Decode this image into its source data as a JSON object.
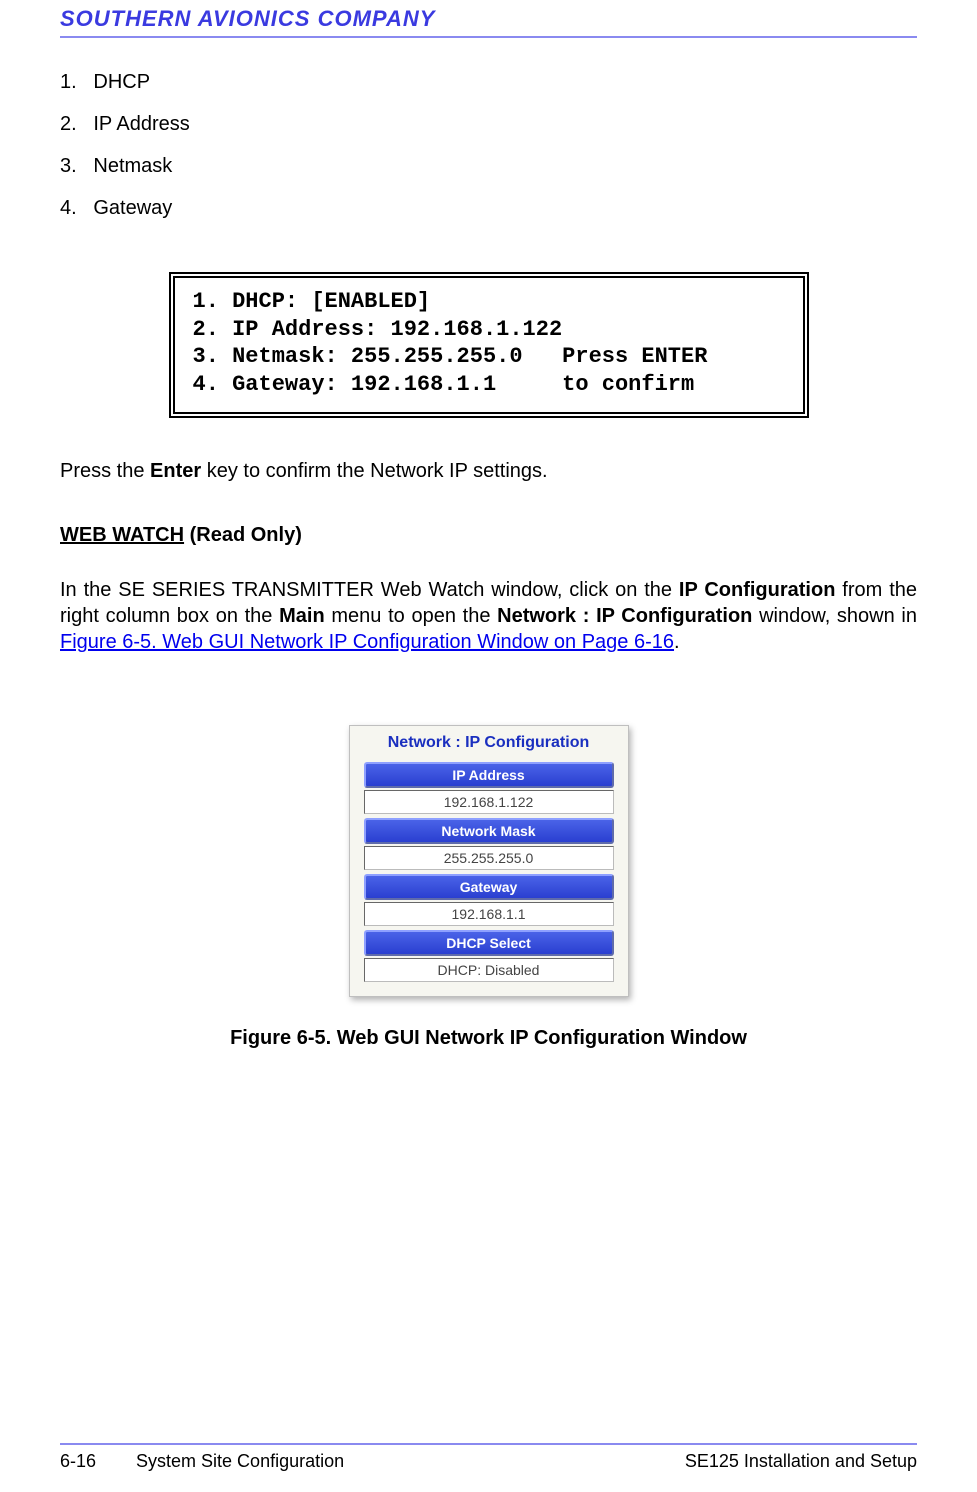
{
  "header": {
    "company": "SOUTHERN AVIONICS COMPANY"
  },
  "list": {
    "items": [
      {
        "num": "1.",
        "label": "DHCP"
      },
      {
        "num": "2.",
        "label": "IP Address"
      },
      {
        "num": "3.",
        "label": "Netmask"
      },
      {
        "num": "4.",
        "label": "Gateway"
      }
    ]
  },
  "lcd": {
    "line1": "1. DHCP: [ENABLED]",
    "line2": "2. IP Address: 192.168.1.122",
    "line3a": "3. Netmask: 255.255.255.0",
    "line3b": "Press ENTER",
    "line4a": "4. Gateway: 192.168.1.1",
    "line4b": "to confirm"
  },
  "para1": {
    "pre": "Press the ",
    "bold": "Enter",
    "post": " key to confirm the Network IP settings."
  },
  "section": {
    "title_ul": "WEB WATCH",
    "title_rest": " (Read Only)"
  },
  "para2": {
    "t1": "In the SE SERIES TRANSMITTER Web Watch window, click on the ",
    "b1": "IP Configuration",
    "t2": " from the right column box on the ",
    "b2": "Main",
    "t3": " menu to open the ",
    "b3": "Network : IP Configuration",
    "t4": " window, shown in ",
    "link": "Figure 6-5.  Web GUI Network IP Configuration Window on Page  6-16",
    "t5": "."
  },
  "gui": {
    "title": "Network : IP Configuration",
    "rows": [
      {
        "label": "IP Address",
        "value": "192.168.1.122"
      },
      {
        "label": "Network Mask",
        "value": "255.255.255.0"
      },
      {
        "label": "Gateway",
        "value": "192.168.1.1"
      },
      {
        "label": "DHCP Select",
        "value": "DHCP: Disabled"
      }
    ]
  },
  "figure_caption": "Figure 6-5.  Web GUI Network IP Configuration Window",
  "footer": {
    "page": "6-16",
    "section": "System Site Configuration",
    "doc": "SE125 Installation and Setup"
  }
}
